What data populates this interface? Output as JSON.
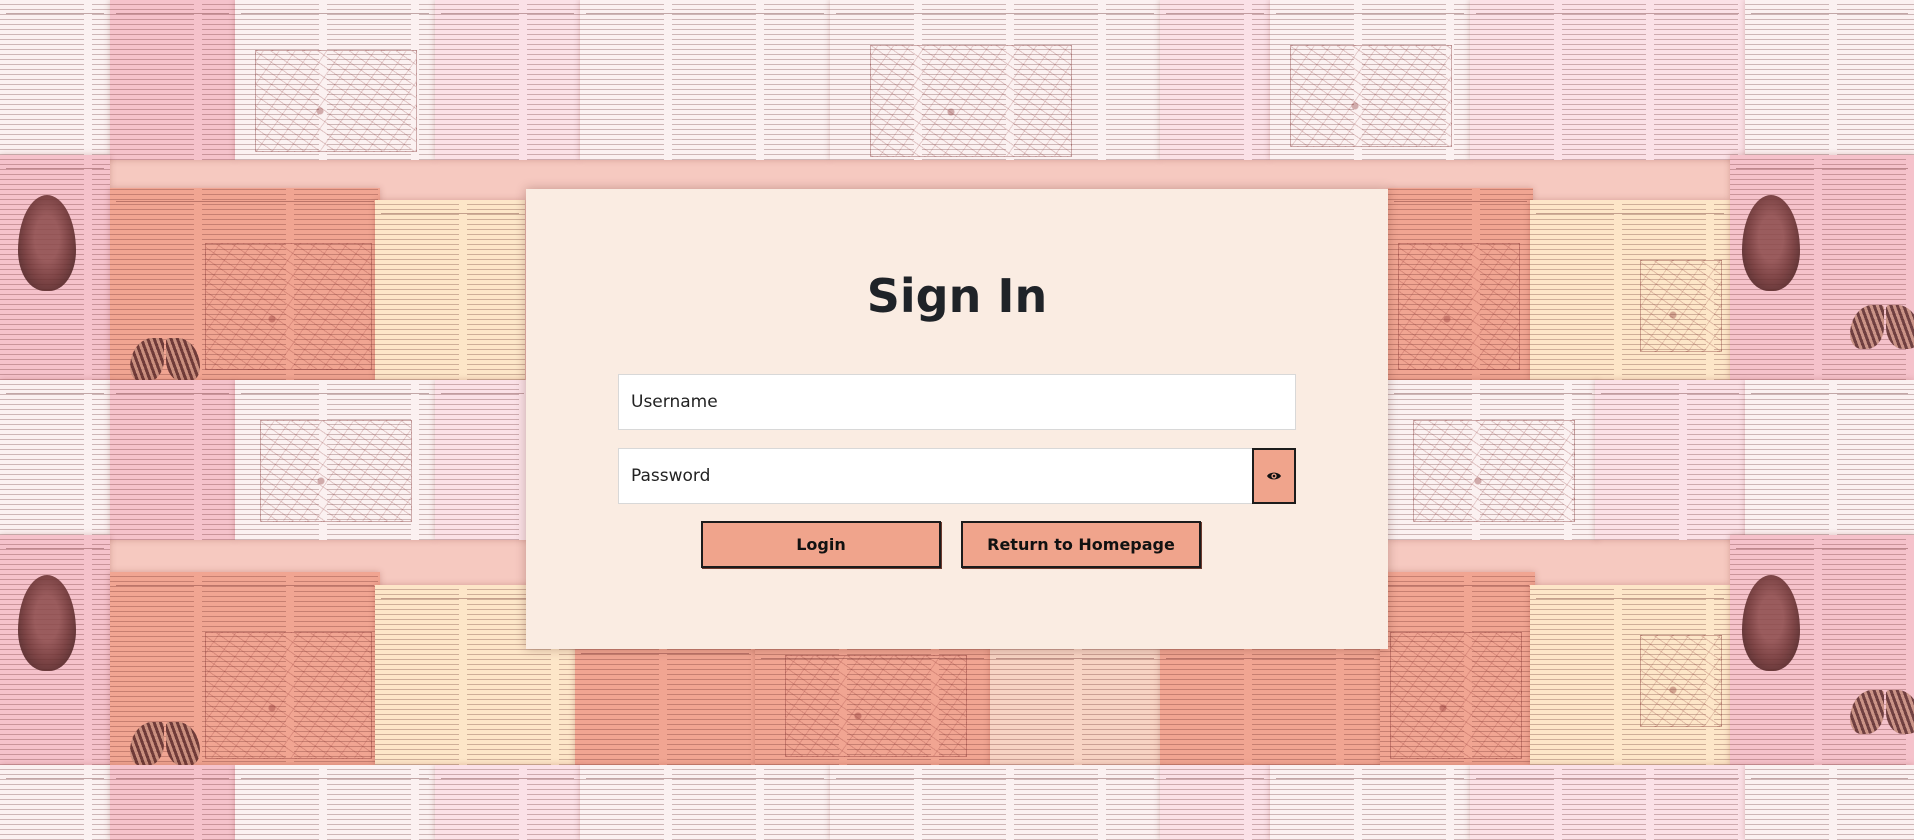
{
  "page": {
    "title": "Sign In"
  },
  "form": {
    "username": {
      "value": "",
      "placeholder": "Username"
    },
    "password": {
      "value": "",
      "placeholder": "Password",
      "toggle_icon": "eye-icon"
    },
    "buttons": {
      "login_label": "Login",
      "return_label": "Return to Homepage"
    }
  },
  "colors": {
    "dialog_background": "#faece2",
    "button_fill": "#f0a48c",
    "button_border": "#1c1c1c",
    "title_text": "#1f2328"
  }
}
